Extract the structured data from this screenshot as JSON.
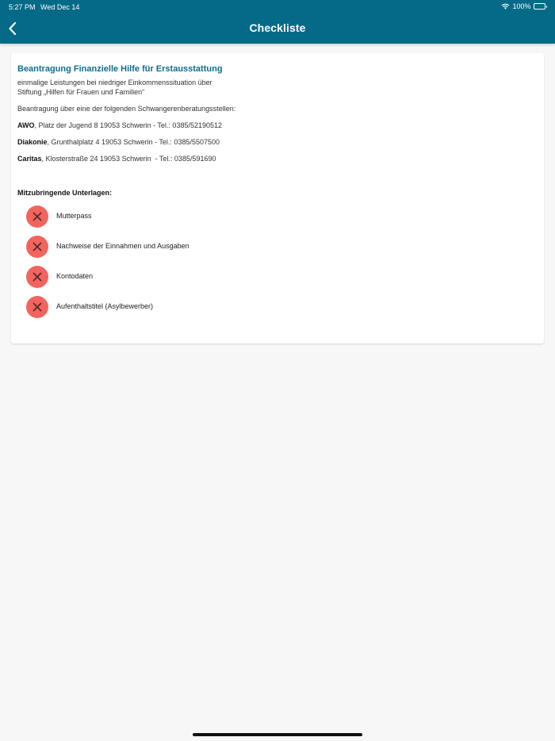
{
  "status_bar": {
    "time": "5:27 PM",
    "date": "Wed Dec 14",
    "battery": "100%",
    "icons": [
      "wifi-icon",
      "battery-icon"
    ]
  },
  "navbar": {
    "title": "Checkliste",
    "back_icon": "chevron-left-icon"
  },
  "card": {
    "title": "Beantragung Finanzielle Hilfe für Erstausstattung",
    "description_line1": "einmalige Leistungen bei niedriger Einkommenssituation über",
    "description_line2": "Stiftung „Hilfen für Frauen und Familien“",
    "intro": "Beantragung über eine der folgenden Schwangerenberatungsstellen:",
    "contacts": [
      {
        "name": "AWO",
        "details": ", Platz der Jugend 8 19053 Schwerin - Tel.: 0385/52190512"
      },
      {
        "name": "Diakonie",
        "details": ", Grunthalplatz 4 19053 Schwerin - Tel.: 0385/5507500"
      },
      {
        "name": "Caritas",
        "details": ", Klosterstraße 24 19053 Schwerin  - Tel.: 0385/591690"
      }
    ],
    "documents_heading": "Mitzubringende Unterlagen:",
    "documents": [
      {
        "label": "Mutterpass",
        "status_icon": "x-icon"
      },
      {
        "label": "Nachweise der Einnahmen und Ausgaben",
        "status_icon": "x-icon"
      },
      {
        "label": "Kontodaten",
        "status_icon": "x-icon"
      },
      {
        "label": "Aufenthaltstitel (Asylbewerber)",
        "status_icon": "x-icon"
      }
    ]
  },
  "colors": {
    "header": "#046a87",
    "title": "#0f6d8a",
    "missing": "#f2645e"
  }
}
